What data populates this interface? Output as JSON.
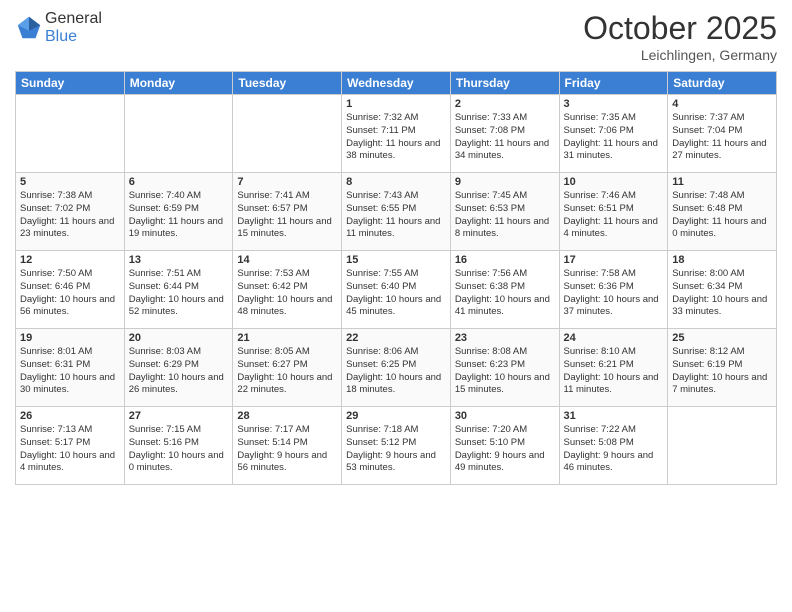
{
  "header": {
    "logo_general": "General",
    "logo_blue": "Blue",
    "month": "October 2025",
    "location": "Leichlingen, Germany"
  },
  "days_of_week": [
    "Sunday",
    "Monday",
    "Tuesday",
    "Wednesday",
    "Thursday",
    "Friday",
    "Saturday"
  ],
  "weeks": [
    [
      {
        "day": "",
        "detail": ""
      },
      {
        "day": "",
        "detail": ""
      },
      {
        "day": "",
        "detail": ""
      },
      {
        "day": "1",
        "detail": "Sunrise: 7:32 AM\nSunset: 7:11 PM\nDaylight: 11 hours\nand 38 minutes."
      },
      {
        "day": "2",
        "detail": "Sunrise: 7:33 AM\nSunset: 7:08 PM\nDaylight: 11 hours\nand 34 minutes."
      },
      {
        "day": "3",
        "detail": "Sunrise: 7:35 AM\nSunset: 7:06 PM\nDaylight: 11 hours\nand 31 minutes."
      },
      {
        "day": "4",
        "detail": "Sunrise: 7:37 AM\nSunset: 7:04 PM\nDaylight: 11 hours\nand 27 minutes."
      }
    ],
    [
      {
        "day": "5",
        "detail": "Sunrise: 7:38 AM\nSunset: 7:02 PM\nDaylight: 11 hours\nand 23 minutes."
      },
      {
        "day": "6",
        "detail": "Sunrise: 7:40 AM\nSunset: 6:59 PM\nDaylight: 11 hours\nand 19 minutes."
      },
      {
        "day": "7",
        "detail": "Sunrise: 7:41 AM\nSunset: 6:57 PM\nDaylight: 11 hours\nand 15 minutes."
      },
      {
        "day": "8",
        "detail": "Sunrise: 7:43 AM\nSunset: 6:55 PM\nDaylight: 11 hours\nand 11 minutes."
      },
      {
        "day": "9",
        "detail": "Sunrise: 7:45 AM\nSunset: 6:53 PM\nDaylight: 11 hours\nand 8 minutes."
      },
      {
        "day": "10",
        "detail": "Sunrise: 7:46 AM\nSunset: 6:51 PM\nDaylight: 11 hours\nand 4 minutes."
      },
      {
        "day": "11",
        "detail": "Sunrise: 7:48 AM\nSunset: 6:48 PM\nDaylight: 11 hours\nand 0 minutes."
      }
    ],
    [
      {
        "day": "12",
        "detail": "Sunrise: 7:50 AM\nSunset: 6:46 PM\nDaylight: 10 hours\nand 56 minutes."
      },
      {
        "day": "13",
        "detail": "Sunrise: 7:51 AM\nSunset: 6:44 PM\nDaylight: 10 hours\nand 52 minutes."
      },
      {
        "day": "14",
        "detail": "Sunrise: 7:53 AM\nSunset: 6:42 PM\nDaylight: 10 hours\nand 48 minutes."
      },
      {
        "day": "15",
        "detail": "Sunrise: 7:55 AM\nSunset: 6:40 PM\nDaylight: 10 hours\nand 45 minutes."
      },
      {
        "day": "16",
        "detail": "Sunrise: 7:56 AM\nSunset: 6:38 PM\nDaylight: 10 hours\nand 41 minutes."
      },
      {
        "day": "17",
        "detail": "Sunrise: 7:58 AM\nSunset: 6:36 PM\nDaylight: 10 hours\nand 37 minutes."
      },
      {
        "day": "18",
        "detail": "Sunrise: 8:00 AM\nSunset: 6:34 PM\nDaylight: 10 hours\nand 33 minutes."
      }
    ],
    [
      {
        "day": "19",
        "detail": "Sunrise: 8:01 AM\nSunset: 6:31 PM\nDaylight: 10 hours\nand 30 minutes."
      },
      {
        "day": "20",
        "detail": "Sunrise: 8:03 AM\nSunset: 6:29 PM\nDaylight: 10 hours\nand 26 minutes."
      },
      {
        "day": "21",
        "detail": "Sunrise: 8:05 AM\nSunset: 6:27 PM\nDaylight: 10 hours\nand 22 minutes."
      },
      {
        "day": "22",
        "detail": "Sunrise: 8:06 AM\nSunset: 6:25 PM\nDaylight: 10 hours\nand 18 minutes."
      },
      {
        "day": "23",
        "detail": "Sunrise: 8:08 AM\nSunset: 6:23 PM\nDaylight: 10 hours\nand 15 minutes."
      },
      {
        "day": "24",
        "detail": "Sunrise: 8:10 AM\nSunset: 6:21 PM\nDaylight: 10 hours\nand 11 minutes."
      },
      {
        "day": "25",
        "detail": "Sunrise: 8:12 AM\nSunset: 6:19 PM\nDaylight: 10 hours\nand 7 minutes."
      }
    ],
    [
      {
        "day": "26",
        "detail": "Sunrise: 7:13 AM\nSunset: 5:17 PM\nDaylight: 10 hours\nand 4 minutes."
      },
      {
        "day": "27",
        "detail": "Sunrise: 7:15 AM\nSunset: 5:16 PM\nDaylight: 10 hours\nand 0 minutes."
      },
      {
        "day": "28",
        "detail": "Sunrise: 7:17 AM\nSunset: 5:14 PM\nDaylight: 9 hours\nand 56 minutes."
      },
      {
        "day": "29",
        "detail": "Sunrise: 7:18 AM\nSunset: 5:12 PM\nDaylight: 9 hours\nand 53 minutes."
      },
      {
        "day": "30",
        "detail": "Sunrise: 7:20 AM\nSunset: 5:10 PM\nDaylight: 9 hours\nand 49 minutes."
      },
      {
        "day": "31",
        "detail": "Sunrise: 7:22 AM\nSunset: 5:08 PM\nDaylight: 9 hours\nand 46 minutes."
      },
      {
        "day": "",
        "detail": ""
      }
    ]
  ]
}
